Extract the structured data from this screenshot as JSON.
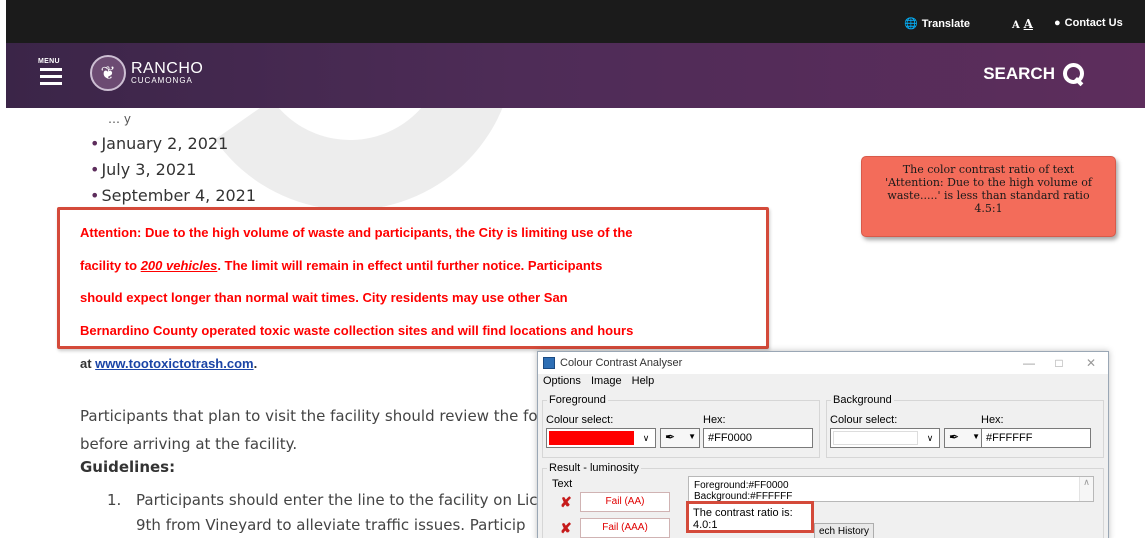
{
  "utility_bar": {
    "translate": "Translate",
    "text_size_small": "A",
    "text_size_large": "A",
    "contact": "Contact Us"
  },
  "header": {
    "menu_label": "MENU",
    "logo_line1": "RANCHO",
    "logo_line2": "CUCAMONGA",
    "search_label": "SEARCH"
  },
  "content": {
    "partial_line": "… y",
    "dates": [
      "January 2, 2021",
      "July 3, 2021",
      "September 4, 2021"
    ],
    "attention": {
      "line1": "Attention: Due to the high volume of waste and participants, the City is limiting use of the",
      "line2_pre": "facility to ",
      "line2_link": "200 vehicles",
      "line2_post": ". The limit will remain in effect until further notice. Participants",
      "line3": "should expect longer than normal wait times. City residents may use other San",
      "line4": "Bernardino County operated toxic waste collection sites and will find locations and hours",
      "cont_pre": "at ",
      "cont_link": "www.tootoxictotrash.com",
      "cont_post": "."
    },
    "para_line1": "Participants that plan to visit the facility should review the fo",
    "para_line2": "before arriving at the facility.",
    "guidelines_heading": "Guidelines:",
    "list_num": "1.",
    "list_line1": "Participants should enter the line to the facility on Lic",
    "list_line2": "9th from Vineyard to alleviate traffic issues.  Particip"
  },
  "callout": {
    "text": "The color contrast ratio of text 'Attention: Due to the high volume of waste.....' is less than standard ratio 4.5:1"
  },
  "cca": {
    "title": "Colour Contrast Analyser",
    "menu": [
      "Options",
      "Image",
      "Help"
    ],
    "foreground": {
      "group": "Foreground",
      "colour_select": "Colour select:",
      "hex_label": "Hex:",
      "hex_value": "#FF0000",
      "swatch": "#ff0000"
    },
    "background": {
      "group": "Background",
      "colour_select": "Colour select:",
      "hex_label": "Hex:",
      "hex_value": "#FFFFFF",
      "swatch": "#ffffff"
    },
    "result": {
      "group": "Result - luminosity",
      "text_label": "Text",
      "fail_aa": "Fail (AA)",
      "fail_aaa": "Fail (AAA)",
      "fg_line": "Foreground:#FF0000",
      "bg_line": "Background:#FFFFFF",
      "ratio": "The contrast ratio is: 4.0:1",
      "history_btn": "Show History",
      "history_btn_visible": "ech History"
    }
  },
  "colors": {
    "header_purple": "#4e2c57",
    "alert_red": "#ff0000",
    "callout_bg": "#f36c5a",
    "highlight_border": "#d44a3a"
  }
}
